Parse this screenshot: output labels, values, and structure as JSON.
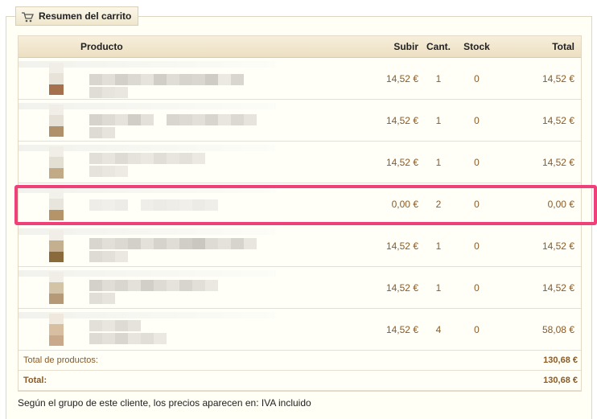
{
  "legend": {
    "title": "Resumen del carrito",
    "icon": "cart-icon"
  },
  "columns": {
    "product": "Producto",
    "price": "Subir",
    "qty": "Cant.",
    "stock": "Stock",
    "total": "Total"
  },
  "rows": [
    {
      "price": "14,52 €",
      "qty": "1",
      "stock": "0",
      "total": "14,52 €"
    },
    {
      "price": "14,52 €",
      "qty": "1",
      "stock": "0",
      "total": "14,52 €"
    },
    {
      "price": "14,52 €",
      "qty": "1",
      "stock": "0",
      "total": "14,52 €"
    },
    {
      "price": "0,00 €",
      "qty": "2",
      "stock": "0",
      "total": "0,00 €"
    },
    {
      "price": "14,52 €",
      "qty": "1",
      "stock": "0",
      "total": "14,52 €"
    },
    {
      "price": "14,52 €",
      "qty": "1",
      "stock": "0",
      "total": "14,52 €"
    },
    {
      "price": "14,52 €",
      "qty": "4",
      "stock": "0",
      "total": "58,08 €"
    }
  ],
  "footer": {
    "products_label": "Total de productos:",
    "products_value": "130,68 €",
    "total_label": "Total:",
    "total_value": "130,68 €"
  },
  "note": "Según el grupo de este cliente, los precios aparecen en: IVA incluido",
  "colors": {
    "highlight": "#f0407a",
    "price_text": "#8a5a26"
  }
}
